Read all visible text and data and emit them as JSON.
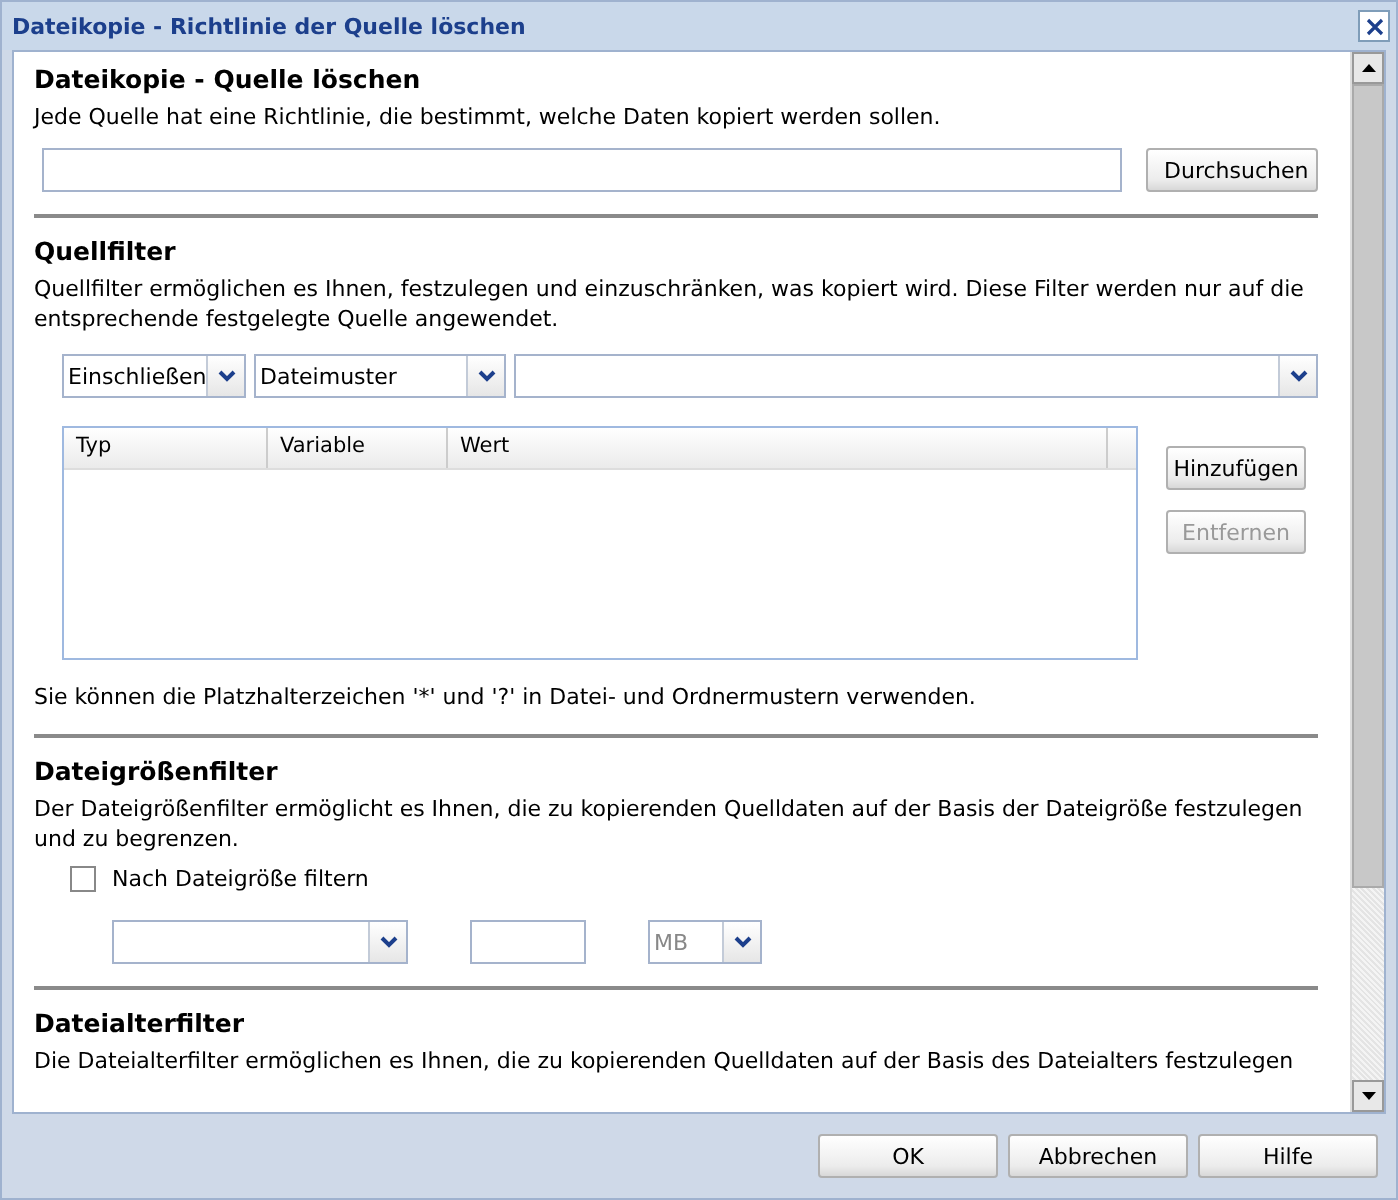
{
  "window": {
    "title": "Dateikopie - Richtlinie der Quelle löschen"
  },
  "source": {
    "heading": "Dateikopie - Quelle löschen",
    "description": "Jede Quelle hat eine Richtlinie, die bestimmt, welche Daten kopiert werden sollen.",
    "browse_button": "Durchsuchen"
  },
  "source_filter": {
    "heading": "Quellfilter",
    "description": "Quellfilter ermöglichen es Ihnen, festzulegen und einzuschränken, was kopiert wird. Diese Filter werden nur auf die entsprechende festgelegte Quelle angewendet.",
    "include_select": "Einschließen",
    "type_select": "Dateimuster",
    "columns": [
      "Typ",
      "Variable",
      "Wert"
    ],
    "buttons": [
      {
        "label": "Hinzufügen",
        "disabled": false
      },
      {
        "label": "Entfernen",
        "disabled": true
      }
    ],
    "hint": "Sie können die Platzhalterzeichen '*' und '?' in Datei- und Ordnermustern verwenden."
  },
  "size_filter": {
    "heading": "Dateigrößenfilter",
    "description": "Der Dateigrößenfilter ermöglicht es Ihnen, die zu kopierenden Quelldaten auf der Basis der Dateigröße festzulegen und zu begrenzen.",
    "checkbox": {
      "label": "Nach Dateigröße filtern",
      "checked": false
    },
    "unit_select": "MB",
    "disabled": true
  },
  "age_filter": {
    "heading": "Dateialterfilter",
    "description": "Die Dateialterfilter ermöglichen es Ihnen, die zu kopierenden Quelldaten auf der Basis des Dateialters festzulegen"
  },
  "buttons": [
    "OK",
    "Abbrechen",
    "Hilfe"
  ]
}
